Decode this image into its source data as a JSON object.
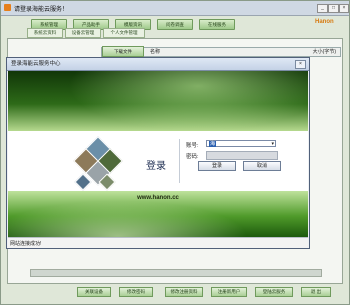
{
  "window": {
    "title": "请登录海能云服务！",
    "controls": [
      "_",
      "□",
      "×"
    ],
    "brand": "Hanon"
  },
  "main_tabs": [
    "系统管理",
    "产品助手",
    "模版资讯",
    "问卷调查",
    "在线服务"
  ],
  "sub_tabs": [
    "系统云资料",
    "设备云管理",
    "个人文件管理"
  ],
  "file_table": {
    "download_button": "下载文件",
    "col_name": "名称",
    "col_size": "大小(字节)"
  },
  "login_dialog": {
    "title": "登录海能云服务中心",
    "close": "×",
    "heading": "登录",
    "account_label": "账号:",
    "account_value": "海",
    "password_label": "密码:",
    "login_button": "登录",
    "cancel_button": "取消",
    "website": "www.hanon.cc",
    "status_text": "网站连接成功!"
  },
  "bottom_actions": [
    "关联设备",
    "修改密码",
    "修改注册资料",
    "注册新用户",
    "登陆云服务",
    "退 出"
  ],
  "colors": {
    "accent": "#2d6a18",
    "tab": "#a9cf95",
    "brand": "#d77a10"
  }
}
